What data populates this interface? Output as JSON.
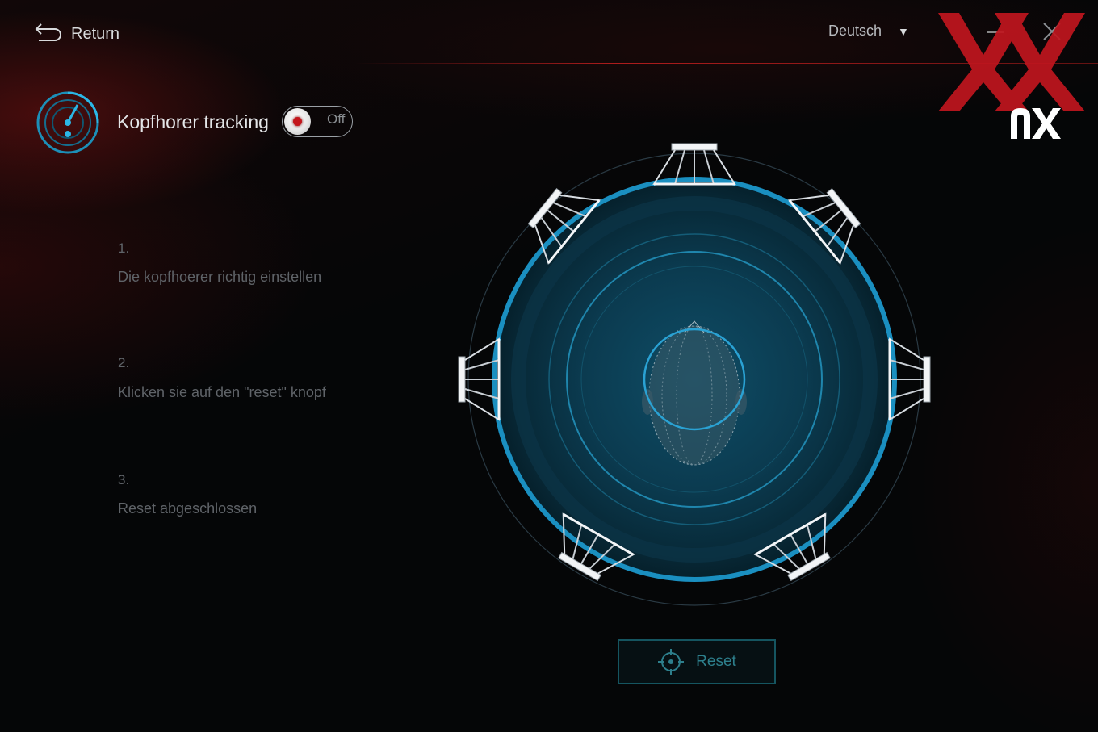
{
  "header": {
    "return_label": "Return",
    "language": "Deutsch",
    "return_icon": "return-arrow-icon",
    "language_dropdown_icon": "triangle-down-icon",
    "minimize_icon": "minimize-icon",
    "close_icon": "close-icon"
  },
  "tracking": {
    "label": "Kopfhorer tracking",
    "toggle_state": "Off",
    "icon": "radar-icon"
  },
  "steps": [
    {
      "number": "1.",
      "text": "Die kopfhoerer richtig einstellen"
    },
    {
      "number": "2.",
      "text": "Klicken sie auf den \"reset\" knopf"
    },
    {
      "number": "3.",
      "text": "Reset abgeschlossen"
    }
  ],
  "visualizer": {
    "speaker_count": 7,
    "head_icon": "head-wireframe-icon",
    "speaker_icon": "speaker-icon"
  },
  "reset": {
    "label": "Reset",
    "icon": "crosshair-icon"
  },
  "colors": {
    "accent_blue": "#1a8fc0",
    "accent_red": "#c4161c",
    "background": "#050607"
  },
  "watermark": {
    "logo_text": "XX nx"
  }
}
